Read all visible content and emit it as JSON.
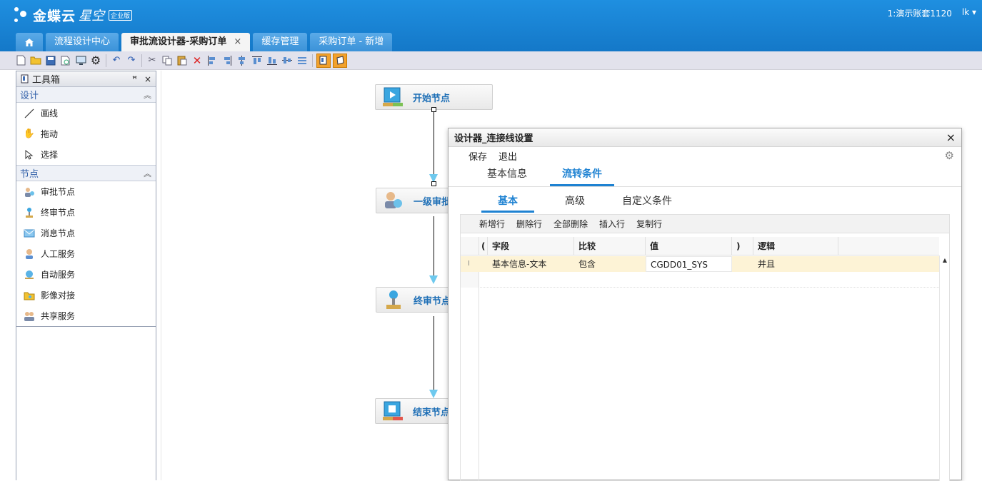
{
  "header": {
    "brand": "金蝶云",
    "brand_sub": "星空",
    "edition_badge": "企业版",
    "account": "1:演示账套1120",
    "user": "lk ▾"
  },
  "tabs": [
    {
      "label": "流程设计中心"
    },
    {
      "label": "审批流设计器-采购订单",
      "close": "×"
    },
    {
      "label": "缓存管理"
    },
    {
      "label": "采购订单 - 新增"
    }
  ],
  "toolbox": {
    "title": "工具箱",
    "pin_icon": "pin-icon",
    "close": "×",
    "sections": [
      {
        "label": "设计",
        "items": [
          {
            "label": "画线",
            "icon": "line-icon"
          },
          {
            "label": "拖动",
            "icon": "hand-icon"
          },
          {
            "label": "选择",
            "icon": "cursor-icon"
          }
        ]
      },
      {
        "label": "节点",
        "items": [
          {
            "label": "审批节点",
            "icon": "approver-icon"
          },
          {
            "label": "终审节点",
            "icon": "final-approve-icon"
          },
          {
            "label": "消息节点",
            "icon": "message-icon"
          },
          {
            "label": "人工服务",
            "icon": "person-icon"
          },
          {
            "label": "自动服务",
            "icon": "auto-icon"
          },
          {
            "label": "影像对接",
            "icon": "image-icon"
          },
          {
            "label": "共享服务",
            "icon": "share-icon"
          }
        ]
      }
    ]
  },
  "canvas": {
    "nodes": [
      {
        "label": "开始节点",
        "icon": "start-node-icon"
      },
      {
        "label": "一级审批",
        "icon": "approver-node-icon"
      },
      {
        "label": "终审节点",
        "icon": "final-node-icon"
      },
      {
        "label": "结束节点",
        "icon": "end-node-icon"
      }
    ]
  },
  "dialog": {
    "title": "设计器_连接线设置",
    "close": "×",
    "menu": {
      "save": "保存",
      "exit": "退出"
    },
    "tabs": [
      {
        "label": "基本信息"
      },
      {
        "label": "流转条件",
        "active": true
      }
    ],
    "subtabs": [
      {
        "label": "基本",
        "active": true
      },
      {
        "label": "高级"
      },
      {
        "label": "自定义条件"
      }
    ],
    "grid_tools": [
      "新增行",
      "删除行",
      "全部删除",
      "插入行",
      "复制行"
    ],
    "columns": [
      "(",
      "字段",
      "比较",
      "值",
      ")",
      "逻辑"
    ],
    "rows": [
      {
        "marker": "I",
        "lparen": "",
        "field": "基本信息-文本",
        "compare": "包含",
        "value": "CGDD01_SYS",
        "rparen": "",
        "logic": "并且"
      }
    ]
  },
  "colors": {
    "header_blue": "#1a84d6",
    "accent_blue": "#1e82d2",
    "node_label": "#1e6fb6",
    "row_highlight": "#fdf3d6"
  }
}
